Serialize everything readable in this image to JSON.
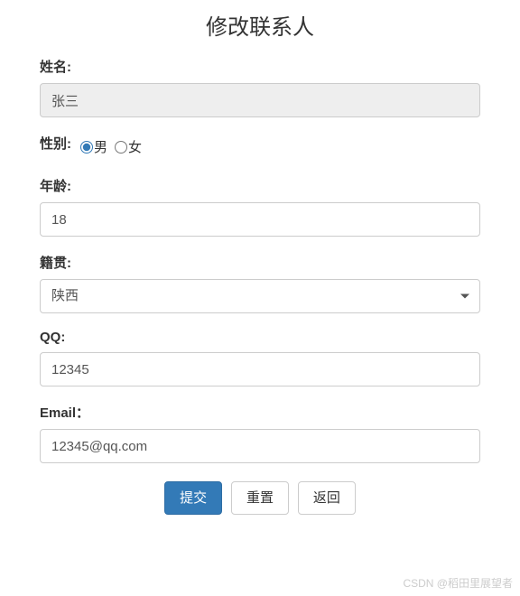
{
  "title": "修改联系人",
  "fields": {
    "name": {
      "label": "姓名:",
      "value": "张三"
    },
    "gender": {
      "label": "性别:",
      "options": {
        "male": "男",
        "female": "女"
      },
      "selected": "male"
    },
    "age": {
      "label": "年龄:",
      "value": "18"
    },
    "origin": {
      "label": "籍贯:",
      "value": "陕西"
    },
    "qq": {
      "label": "QQ:",
      "value": "12345"
    },
    "email": {
      "label": "Email：",
      "value": "12345@qq.com"
    }
  },
  "buttons": {
    "submit": "提交",
    "reset": "重置",
    "back": "返回"
  },
  "watermark": "CSDN @稻田里展望者"
}
